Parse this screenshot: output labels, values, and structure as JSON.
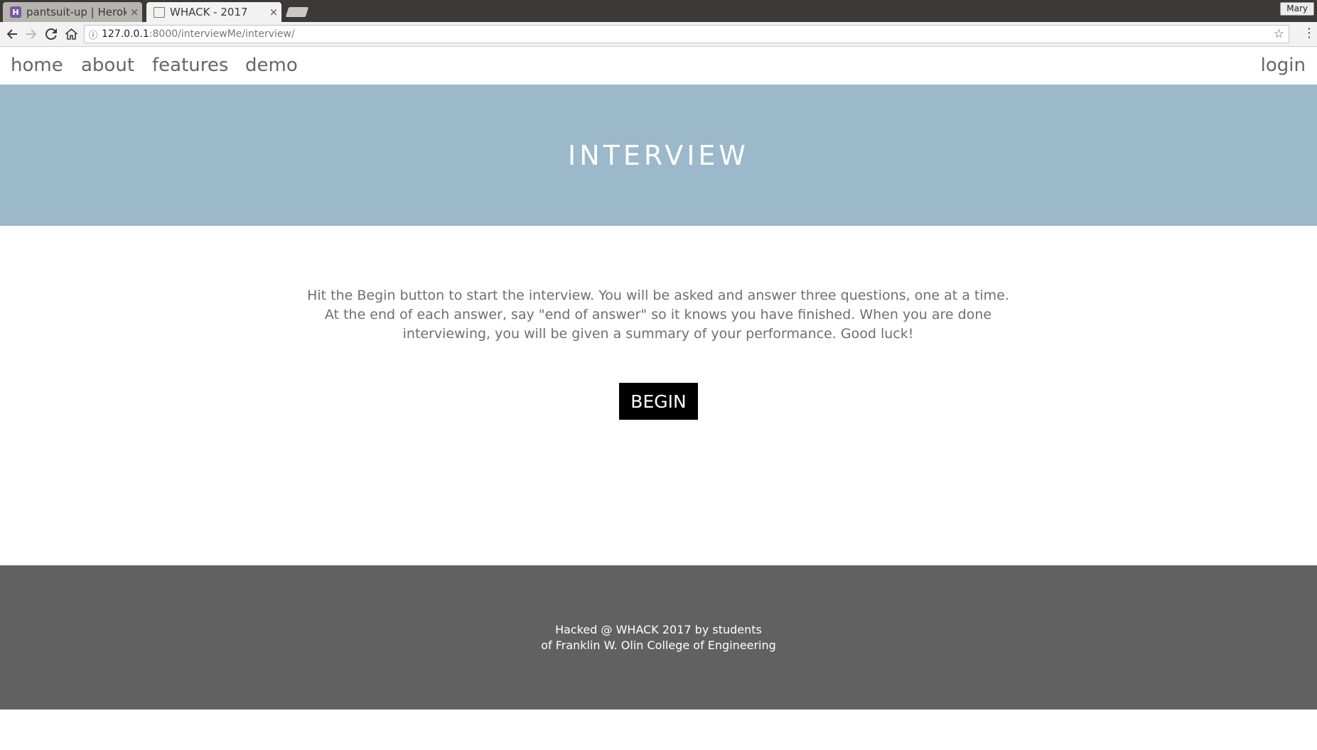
{
  "browser": {
    "tabs": [
      {
        "title": "pantsuit-up | Herok",
        "favicon": "heroku-icon",
        "active": false
      },
      {
        "title": "WHACK - 2017",
        "favicon": "page-icon",
        "active": true
      }
    ],
    "tab_close": "×",
    "profile": "Mary",
    "url_host": "127.0.0.1",
    "url_path": ":8000/interviewMe/interview/",
    "icons": {
      "back": "back-arrow-icon",
      "forward": "forward-arrow-icon",
      "reload": "reload-icon",
      "home": "home-icon",
      "info": "info-icon",
      "bookmark": "star-icon",
      "menu": "menu-dots-icon"
    }
  },
  "nav": {
    "home": "home",
    "about": "about",
    "features": "features",
    "demo": "demo",
    "login": "login"
  },
  "hero": {
    "title": "INTERVIEW",
    "background": "#9cb8cb"
  },
  "main": {
    "instructions": "Hit the Begin button to start the interview. You will be asked and answer three questions, one at a time. At the end of each answer, say \"end of answer\" so it knows you have finished. When you are done interviewing, you will be given a summary of your performance. Good luck!",
    "begin_label": "BEGIN"
  },
  "footer": {
    "line1": "Hacked @ WHACK 2017 by students",
    "line2": "of Franklin W. Olin College of Engineering",
    "background": "#616161"
  }
}
